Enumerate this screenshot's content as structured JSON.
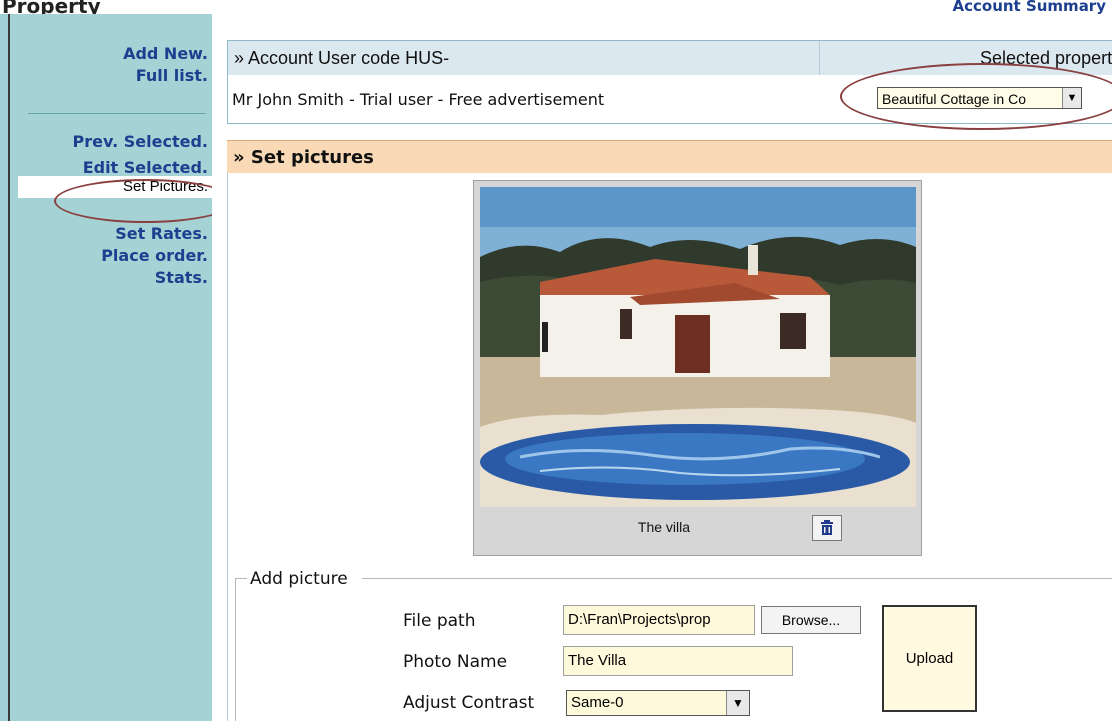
{
  "top": {
    "left_cut": "Property",
    "right_title": "Account Summary"
  },
  "sidebar": {
    "items": [
      {
        "label": "Add New."
      },
      {
        "label": "Full list."
      },
      {
        "label": "Prev. Selected."
      },
      {
        "label": "Edit Selected."
      },
      {
        "label": "Set Pictures."
      },
      {
        "label": "Set Rates."
      },
      {
        "label": "Place order."
      },
      {
        "label": "Stats."
      }
    ]
  },
  "account": {
    "title": "» Account User code HUS-",
    "selected_label": "Selected property",
    "user_line": "Mr John Smith - Trial user - Free advertisement",
    "property_select": "Beautiful Cottage in Co"
  },
  "pictures": {
    "section_title": "» Set pictures",
    "items": [
      {
        "caption": "The villa"
      }
    ]
  },
  "add_picture": {
    "legend": "Add picture",
    "file_path_label": "File path",
    "file_path_value": "D:\\Fran\\Projects\\prop",
    "browse_label": "Browse...",
    "photo_name_label": "Photo Name",
    "photo_name_value": "The Villa",
    "contrast_label": "Adjust Contrast",
    "contrast_value": "Same-0",
    "upload_label": "Upload"
  },
  "icons": {
    "delete": "trash-icon",
    "dropdown": "chevron-down-icon"
  },
  "colors": {
    "sidebar_bg": "#a5d3d5",
    "link": "#1c3f8f",
    "section_header": "#fad9b6",
    "account_header": "#dce8ef",
    "input_bg": "#fff9dc",
    "annotation_oval": "#8a4040"
  }
}
